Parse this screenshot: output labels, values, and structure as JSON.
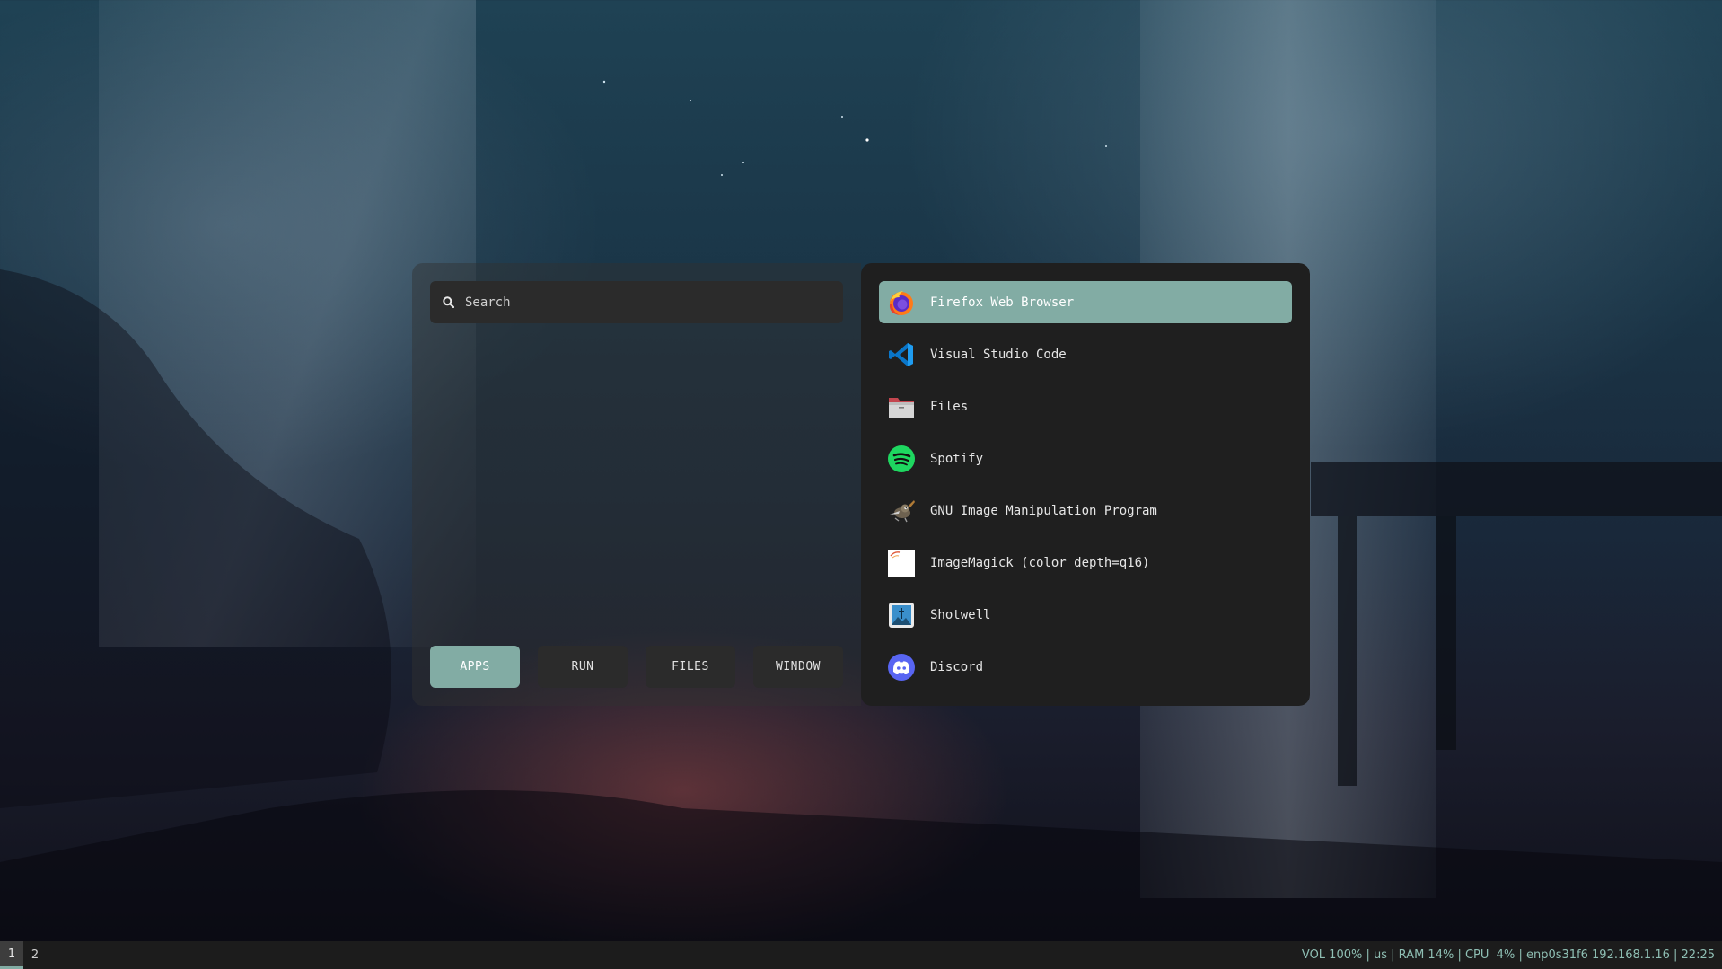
{
  "search": {
    "placeholder": "Search",
    "icon": "search-icon"
  },
  "modes": [
    {
      "label": "APPS",
      "active": true
    },
    {
      "label": "RUN",
      "active": false
    },
    {
      "label": "FILES",
      "active": false
    },
    {
      "label": "WINDOW",
      "active": false
    }
  ],
  "apps": [
    {
      "label": "Firefox Web Browser",
      "icon": "firefox-icon",
      "selected": true
    },
    {
      "label": "Visual Studio Code",
      "icon": "vscode-icon"
    },
    {
      "label": "Files",
      "icon": "files-icon"
    },
    {
      "label": "Spotify",
      "icon": "spotify-icon"
    },
    {
      "label": "GNU Image Manipulation Program",
      "icon": "gimp-icon"
    },
    {
      "label": "ImageMagick (color depth=q16)",
      "icon": "imagemagick-icon"
    },
    {
      "label": "Shotwell",
      "icon": "shotwell-icon"
    },
    {
      "label": "Discord",
      "icon": "discord-icon"
    }
  ],
  "taskbar": {
    "workspaces": [
      "1",
      "2"
    ],
    "status": {
      "vol": "VOL 100%",
      "layout": "us",
      "ram": "RAM 14%",
      "cpu": "CPU  4%",
      "net": "enp0s31f6 192.168.1.16",
      "time": "22:25"
    }
  },
  "colors": {
    "accent": "#82aca4",
    "panel": "#1f1f1f",
    "taskbar": "#1c1c1c"
  }
}
